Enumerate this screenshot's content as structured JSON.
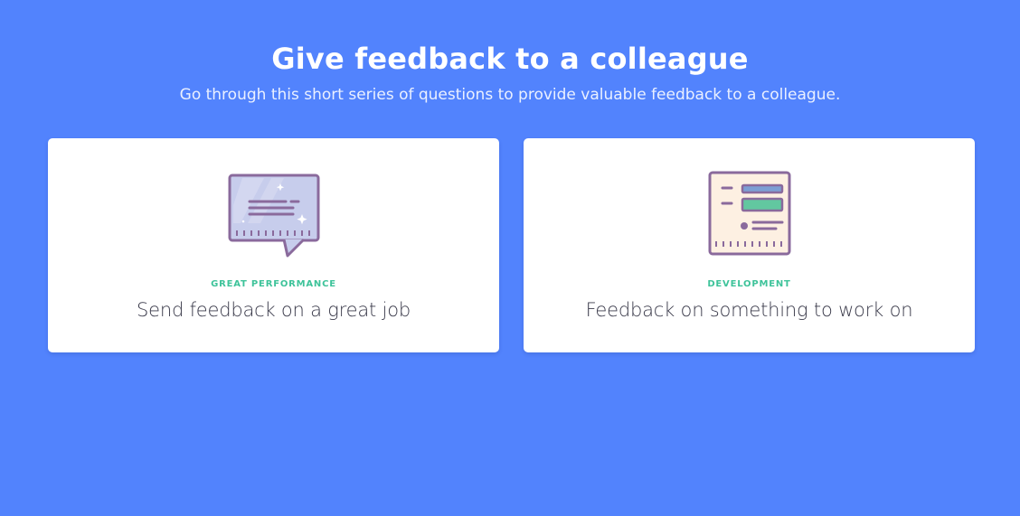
{
  "header": {
    "title": "Give feedback to a colleague",
    "subtitle": "Go through this short series of questions to provide valuable feedback to a colleague."
  },
  "cards": [
    {
      "icon": "speech-bubble-icon",
      "category": "GREAT PERFORMANCE",
      "title": "Send feedback on a great job"
    },
    {
      "icon": "document-form-icon",
      "category": "DEVELOPMENT",
      "title": "Feedback on something to work on"
    }
  ],
  "colors": {
    "background": "#5283fd",
    "card": "#ffffff",
    "category": "#3ec39a",
    "icon_stroke": "#8a6a9c"
  }
}
